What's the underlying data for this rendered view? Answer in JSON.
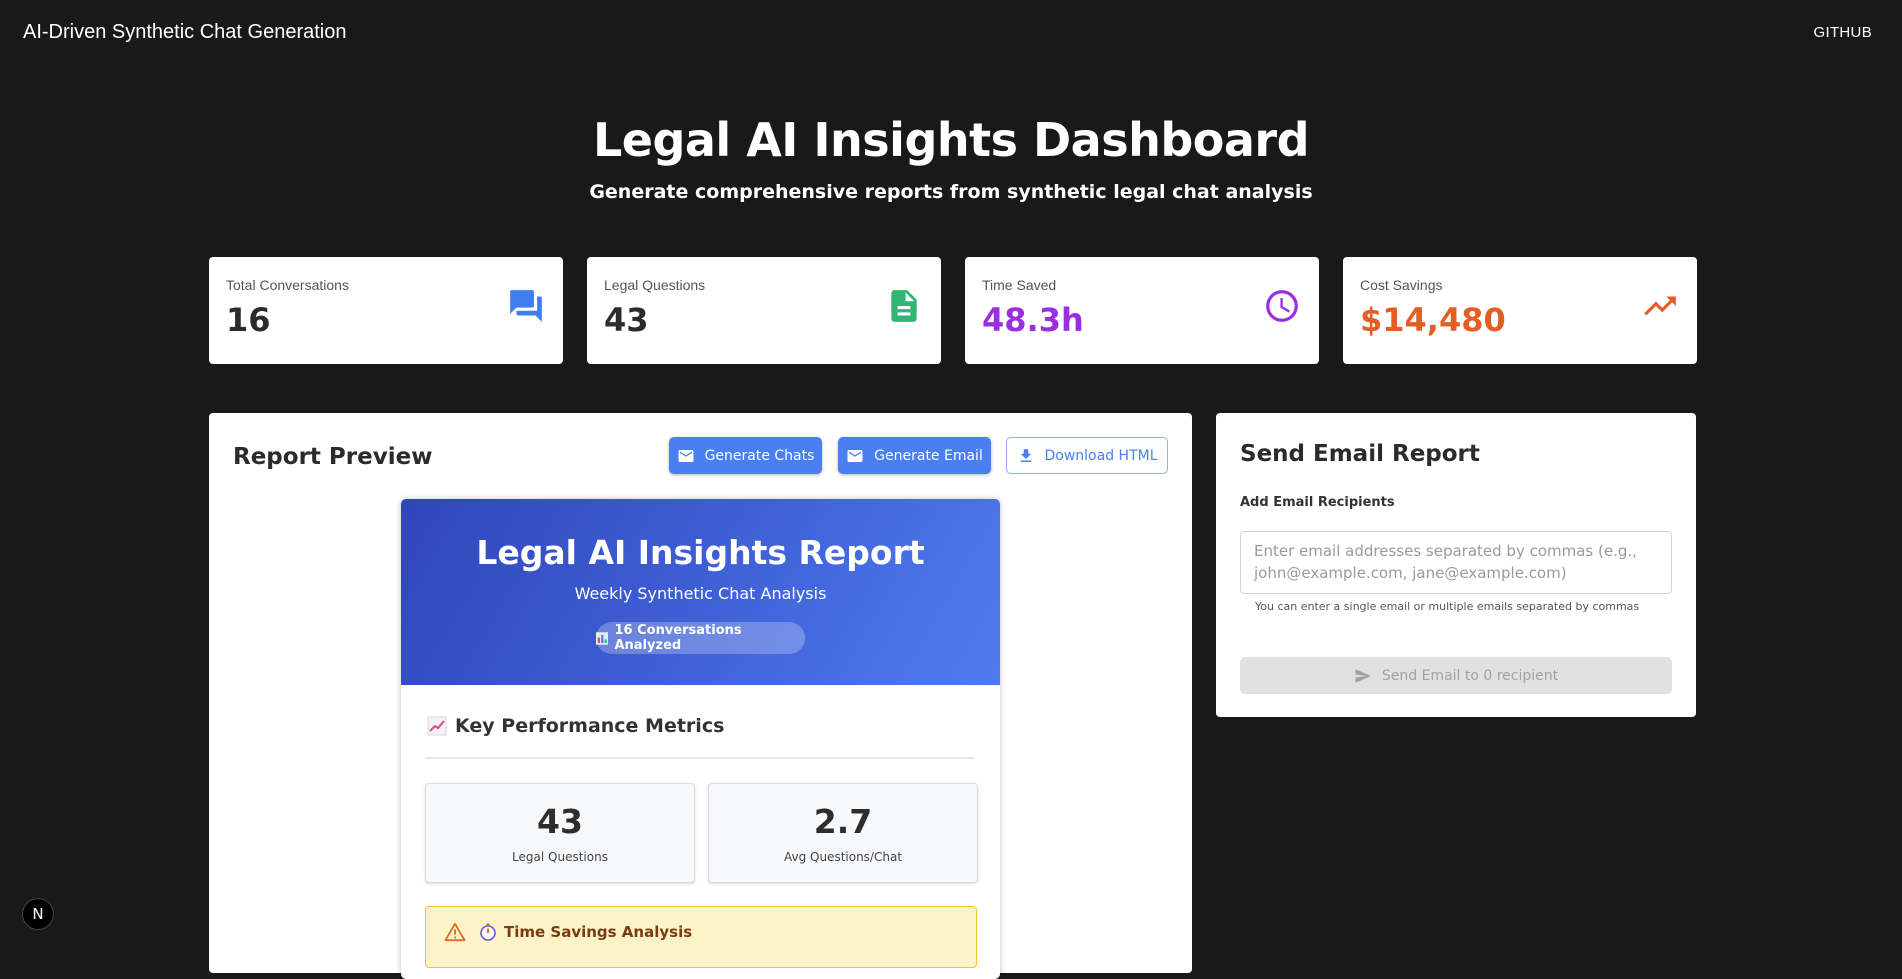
{
  "nav": {
    "title": "AI-Driven Synthetic Chat Generation",
    "github": "GITHUB"
  },
  "hero": {
    "title": "Legal AI Insights Dashboard",
    "subtitle": "Generate comprehensive reports from synthetic legal chat analysis"
  },
  "stats": [
    {
      "label": "Total Conversations",
      "value": "16",
      "color": "#2b2b2b",
      "icon": "chat-bubbles-icon",
      "icon_color": "#3f7ef0"
    },
    {
      "label": "Legal Questions",
      "value": "43",
      "color": "#2b2b2b",
      "icon": "document-icon",
      "icon_color": "#2fb574"
    },
    {
      "label": "Time Saved",
      "value": "48.3h",
      "color": "#9a2fe0",
      "icon": "clock-icon",
      "icon_color": "#9a2fe0"
    },
    {
      "label": "Cost Savings",
      "value": "$14,480",
      "color": "#e35e24",
      "icon": "trending-up-icon",
      "icon_color": "#e35e24"
    }
  ],
  "report": {
    "title": "Report Preview",
    "buttons": {
      "generate_chats": "Generate Chats",
      "generate_email": "Generate Email",
      "download_html": "Download HTML"
    },
    "doc": {
      "title": "Legal AI Insights Report",
      "subtitle": "Weekly Synthetic Chat Analysis",
      "pill": "16 Conversations Analyzed",
      "section": "Key Performance Metrics",
      "metrics": [
        {
          "value": "43",
          "label": "Legal Questions"
        },
        {
          "value": "2.7",
          "label": "Avg Questions/Chat"
        }
      ],
      "warning": "Time Savings Analysis"
    }
  },
  "email": {
    "title": "Send Email Report",
    "field_label": "Add Email Recipients",
    "placeholder": "Enter email addresses separated by commas (e.g., john@example.com, jane@example.com)",
    "value": "",
    "helper": "You can enter a single email or multiple emails separated by commas",
    "send_label": "Send Email to 0 recipient"
  },
  "badge": "N",
  "colors": {
    "accent": "#4a7ff0",
    "background": "#191919"
  }
}
